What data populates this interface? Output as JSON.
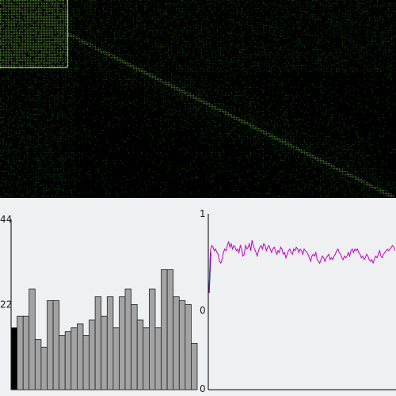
{
  "colors": {
    "matrix_background": "#000000",
    "matrix_dot": "#1fae1f",
    "matrix_highlight": "#8fe860",
    "panel_background": "#eef0f2",
    "bar_fill": "#a3a3a3",
    "bar_stroke": "#222222",
    "first_bar_fill": "#000000",
    "line_color": "#c000c0",
    "line_start_color": "#1a1a8a"
  },
  "matrix": {
    "type": "heatmap",
    "highlight_cluster_fraction": 0.17
  },
  "chart_data": [
    {
      "type": "bar",
      "ylim": [
        0,
        44
      ],
      "yticks": [
        "44",
        "22"
      ],
      "values": [
        16,
        19,
        19,
        26,
        13,
        11,
        23,
        23,
        14,
        15,
        16,
        17,
        14,
        18,
        24,
        19,
        24,
        16,
        24,
        26,
        22,
        18,
        16,
        26,
        16,
        31,
        31,
        24,
        23,
        22,
        12
      ]
    },
    {
      "type": "line",
      "ylim": [
        0,
        1
      ],
      "yticks": [
        "1",
        "0",
        "0"
      ],
      "values": [
        0.55,
        0.79,
        0.82,
        0.81,
        0.79,
        0.8,
        0.78,
        0.77,
        0.73,
        0.72,
        0.74,
        0.78,
        0.8,
        0.79,
        0.82,
        0.84,
        0.81,
        0.83,
        0.8,
        0.82,
        0.81,
        0.79,
        0.8,
        0.78,
        0.82,
        0.8,
        0.76,
        0.77,
        0.82,
        0.8,
        0.81,
        0.83,
        0.79,
        0.85,
        0.82,
        0.8,
        0.78,
        0.76,
        0.79,
        0.81,
        0.82,
        0.8,
        0.83,
        0.82,
        0.79,
        0.81,
        0.82,
        0.8,
        0.78,
        0.8,
        0.81,
        0.79,
        0.77,
        0.79,
        0.78,
        0.81,
        0.8,
        0.77,
        0.78,
        0.75,
        0.77,
        0.79,
        0.8,
        0.78,
        0.77,
        0.8,
        0.79,
        0.81,
        0.8,
        0.78,
        0.8,
        0.79,
        0.77,
        0.8,
        0.79,
        0.78,
        0.77,
        0.75,
        0.73,
        0.76,
        0.77,
        0.76,
        0.78,
        0.74,
        0.73,
        0.72,
        0.74,
        0.76,
        0.75,
        0.73,
        0.75,
        0.76,
        0.77,
        0.74,
        0.75,
        0.74,
        0.76,
        0.77,
        0.79,
        0.8,
        0.78,
        0.77,
        0.75,
        0.74,
        0.76,
        0.75,
        0.76,
        0.78,
        0.76,
        0.79,
        0.8,
        0.78,
        0.8,
        0.79,
        0.8,
        0.78,
        0.77,
        0.75,
        0.76,
        0.74,
        0.75,
        0.77,
        0.76,
        0.74,
        0.73,
        0.74,
        0.72,
        0.74,
        0.76,
        0.75,
        0.77,
        0.79,
        0.76,
        0.75,
        0.77,
        0.78,
        0.79,
        0.8,
        0.79,
        0.8,
        0.81,
        0.82,
        0.81,
        0.79
      ]
    }
  ]
}
